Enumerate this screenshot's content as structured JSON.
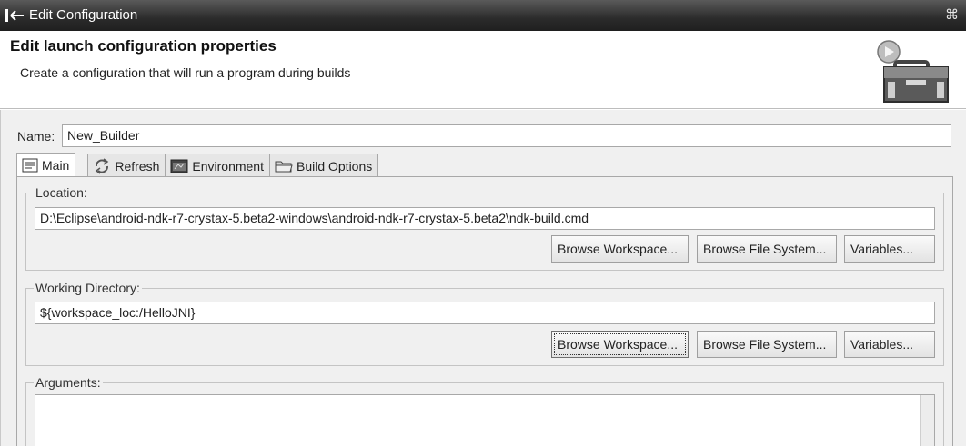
{
  "window": {
    "title": "Edit Configuration",
    "close_glyph": "⌘"
  },
  "banner": {
    "heading": "Edit launch configuration properties",
    "description": "Create a configuration that will run a program during builds"
  },
  "name_field": {
    "label": "Name:",
    "value": "New_Builder"
  },
  "tabs": [
    {
      "label": "Main",
      "icon": "main-tab-icon",
      "active": true
    },
    {
      "label": "Refresh",
      "icon": "refresh-icon",
      "active": false
    },
    {
      "label": "Environment",
      "icon": "environment-icon",
      "active": false
    },
    {
      "label": "Build Options",
      "icon": "folder-icon",
      "active": false
    }
  ],
  "location": {
    "label": "Location:",
    "value": "D:\\Eclipse\\android-ndk-r7-crystax-5.beta2-windows\\android-ndk-r7-crystax-5.beta2\\ndk-build.cmd",
    "buttons": {
      "workspace": "Browse Workspace...",
      "file_system": "Browse File System...",
      "variables": "Variables..."
    }
  },
  "working_directory": {
    "label": "Working Directory:",
    "value": "${workspace_loc:/HelloJNI}",
    "buttons": {
      "workspace": "Browse Workspace...",
      "file_system": "Browse File System...",
      "variables": "Variables..."
    }
  },
  "arguments": {
    "label": "Arguments:",
    "value": ""
  }
}
